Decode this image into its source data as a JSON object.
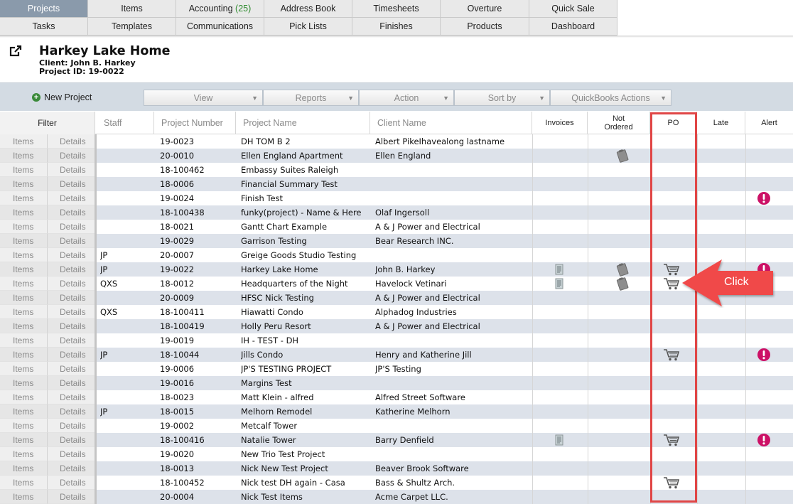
{
  "nav": {
    "row1": [
      {
        "label": "Projects",
        "active": true
      },
      {
        "label": "Items"
      },
      {
        "label": "Accounting",
        "count": "(25)"
      },
      {
        "label": "Address Book"
      },
      {
        "label": "Timesheets"
      },
      {
        "label": "Overture"
      },
      {
        "label": "Quick Sale"
      }
    ],
    "row2": [
      {
        "label": "Tasks"
      },
      {
        "label": "Templates"
      },
      {
        "label": "Communications"
      },
      {
        "label": "Pick Lists"
      },
      {
        "label": "Finishes"
      },
      {
        "label": "Products"
      },
      {
        "label": "Dashboard"
      }
    ]
  },
  "project": {
    "title": "Harkey Lake Home",
    "client": "Client: John B. Harkey",
    "project_id": "Project ID: 19-0022"
  },
  "toolbar": {
    "new_project": "New Project",
    "dropdowns": [
      "View",
      "Reports",
      "Action",
      "Sort by",
      "QuickBooks Actions"
    ]
  },
  "table": {
    "headers": {
      "filter": "Filter",
      "staff": "Staff",
      "project_number": "Project Number",
      "project_name": "Project Name",
      "client_name": "Client Name",
      "invoices": "Invoices",
      "not_ordered_1": "Not",
      "not_ordered_2": "Ordered",
      "po": "PO",
      "late": "Late",
      "alert": "Alert"
    },
    "items_label": "Items",
    "details_label": "Details",
    "rows": [
      {
        "staff": "",
        "number": "19-0023",
        "name": "DH TOM B 2",
        "client": "Albert PikeIhavealong lastname",
        "invoice": false,
        "not_ordered": false,
        "po": false,
        "alert": false
      },
      {
        "staff": "",
        "number": "20-0010",
        "name": "Ellen England Apartment",
        "client": "Ellen England",
        "invoice": false,
        "not_ordered": true,
        "po": false,
        "alert": false
      },
      {
        "staff": "",
        "number": "18-100462",
        "name": "Embassy Suites Raleigh",
        "client": "",
        "invoice": false,
        "not_ordered": false,
        "po": false,
        "alert": false
      },
      {
        "staff": "",
        "number": "18-0006",
        "name": "Financial Summary Test",
        "client": "",
        "invoice": false,
        "not_ordered": false,
        "po": false,
        "alert": false
      },
      {
        "staff": "",
        "number": "19-0024",
        "name": "Finish Test",
        "client": "",
        "invoice": false,
        "not_ordered": false,
        "po": false,
        "alert": true
      },
      {
        "staff": "",
        "number": "18-100438",
        "name": "funky(project) - Name & Here",
        "client": "Olaf Ingersoll",
        "invoice": false,
        "not_ordered": false,
        "po": false,
        "alert": false
      },
      {
        "staff": "",
        "number": "18-0021",
        "name": "Gantt Chart Example",
        "client": "A & J Power and Electrical",
        "invoice": false,
        "not_ordered": false,
        "po": false,
        "alert": false
      },
      {
        "staff": "",
        "number": "19-0029",
        "name": "Garrison Testing",
        "client": "Bear Research INC.",
        "invoice": false,
        "not_ordered": false,
        "po": false,
        "alert": false
      },
      {
        "staff": "JP",
        "number": "20-0007",
        "name": "Greige Goods Studio Testing",
        "client": "",
        "invoice": false,
        "not_ordered": false,
        "po": false,
        "alert": false
      },
      {
        "staff": "JP",
        "number": "19-0022",
        "name": "Harkey Lake Home",
        "client": "John B. Harkey",
        "invoice": true,
        "not_ordered": true,
        "po": true,
        "alert": true
      },
      {
        "staff": "QXS",
        "number": "18-0012",
        "name": "Headquarters of the Night",
        "client": "Havelock Vetinari",
        "invoice": true,
        "not_ordered": true,
        "po": true,
        "alert": false
      },
      {
        "staff": "",
        "number": "20-0009",
        "name": "HFSC Nick Testing",
        "client": "A & J Power and Electrical",
        "invoice": false,
        "not_ordered": false,
        "po": false,
        "alert": false
      },
      {
        "staff": "QXS",
        "number": "18-100411",
        "name": "Hiawatti Condo",
        "client": "Alphadog Industries",
        "invoice": false,
        "not_ordered": false,
        "po": false,
        "alert": false
      },
      {
        "staff": "",
        "number": "18-100419",
        "name": "Holly Peru Resort",
        "client": "A & J Power and Electrical",
        "invoice": false,
        "not_ordered": false,
        "po": false,
        "alert": false
      },
      {
        "staff": "",
        "number": "19-0019",
        "name": "IH - TEST - DH",
        "client": "",
        "invoice": false,
        "not_ordered": false,
        "po": false,
        "alert": false
      },
      {
        "staff": "JP",
        "number": "18-10044",
        "name": "Jills Condo",
        "client": "Henry and Katherine Jill",
        "invoice": false,
        "not_ordered": false,
        "po": true,
        "alert": true
      },
      {
        "staff": "",
        "number": "19-0006",
        "name": "JP'S TESTING PROJECT",
        "client": "JP'S Testing",
        "invoice": false,
        "not_ordered": false,
        "po": false,
        "alert": false
      },
      {
        "staff": "",
        "number": "19-0016",
        "name": "Margins Test",
        "client": "",
        "invoice": false,
        "not_ordered": false,
        "po": false,
        "alert": false
      },
      {
        "staff": "",
        "number": "18-0023",
        "name": "Matt Klein - alfred",
        "client": "Alfred Street Software",
        "invoice": false,
        "not_ordered": false,
        "po": false,
        "alert": false
      },
      {
        "staff": "JP",
        "number": "18-0015",
        "name": "Melhorn Remodel",
        "client": "Katherine Melhorn",
        "invoice": false,
        "not_ordered": false,
        "po": false,
        "alert": false
      },
      {
        "staff": "",
        "number": "19-0002",
        "name": "Metcalf Tower",
        "client": "",
        "invoice": false,
        "not_ordered": false,
        "po": false,
        "alert": false
      },
      {
        "staff": "",
        "number": "18-100416",
        "name": "Natalie Tower",
        "client": "Barry Denfield",
        "invoice": true,
        "not_ordered": false,
        "po": true,
        "alert": true
      },
      {
        "staff": "",
        "number": "19-0020",
        "name": "New Trio Test Project",
        "client": "",
        "invoice": false,
        "not_ordered": false,
        "po": false,
        "alert": false
      },
      {
        "staff": "",
        "number": "18-0013",
        "name": "Nick New Test Project",
        "client": "Beaver Brook Software",
        "invoice": false,
        "not_ordered": false,
        "po": false,
        "alert": false
      },
      {
        "staff": "",
        "number": "18-100452",
        "name": "Nick test DH again - Casa",
        "client": "Bass & Shultz Arch.",
        "invoice": false,
        "not_ordered": false,
        "po": true,
        "alert": false
      },
      {
        "staff": "",
        "number": "20-0004",
        "name": "Nick Test Items",
        "client": "Acme Carpet LLC.",
        "invoice": false,
        "not_ordered": false,
        "po": false,
        "alert": false
      }
    ]
  },
  "annotation": {
    "callout_text": "Click",
    "color": "#f04a4a"
  },
  "colors": {
    "active_tab": "#8a9aab",
    "toolbar_bg": "#d3dbe3",
    "row_alt": "#dde2ea",
    "alert": "#cc1166",
    "count_green": "#2e8b2e"
  }
}
